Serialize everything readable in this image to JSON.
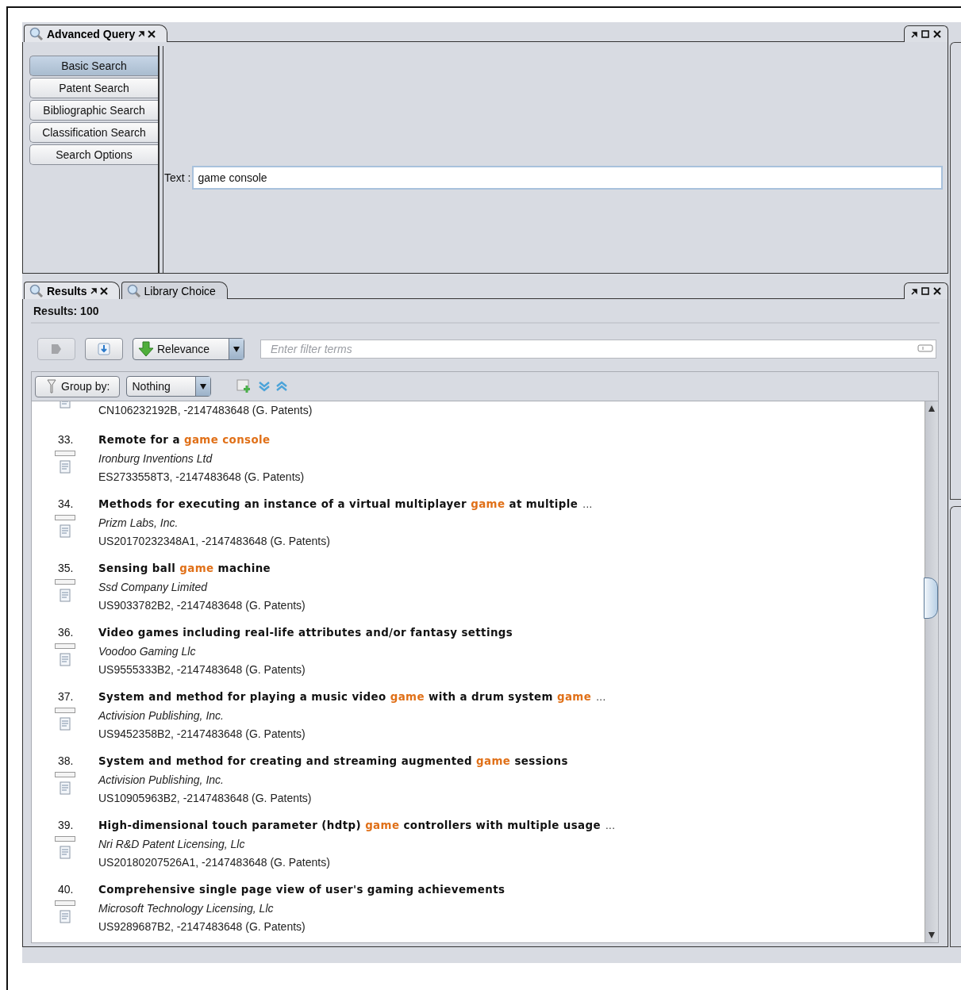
{
  "query_panel": {
    "tab": {
      "label": "Advanced Query",
      "selected": true,
      "closable": true
    },
    "nav": [
      {
        "label": "Basic Search",
        "selected": true
      },
      {
        "label": "Patent Search",
        "selected": false
      },
      {
        "label": "Bibliographic Search",
        "selected": false
      },
      {
        "label": "Classification Search",
        "selected": false
      },
      {
        "label": "Search Options",
        "selected": false
      }
    ],
    "text_field": {
      "label": "Text :",
      "value": "game console"
    }
  },
  "results_panel": {
    "tabs": [
      {
        "label": "Results",
        "selected": true,
        "closable": true
      },
      {
        "label": "Library Choice",
        "selected": false,
        "closable": false
      }
    ],
    "count": "Results: 100",
    "toolbar_buttons": [
      {
        "kind": "export",
        "disabled": true
      },
      {
        "kind": "download",
        "disabled": false
      }
    ],
    "sort": {
      "value": "Relevance"
    },
    "filter": {
      "placeholder": "Enter filter terms"
    },
    "group_by": {
      "label": "Group by:",
      "value": "Nothing"
    },
    "results": [
      {
        "id": "CN106232192B, -2147483648 (G. Patents)"
      },
      {
        "number": "33.",
        "checked": false,
        "title": [
          {
            "text": "Remote for a ",
            "match": false
          },
          {
            "text": "game console",
            "match": true
          }
        ],
        "assignee": "Ironburg Inventions Ltd",
        "id": "ES2733558T3, -2147483648 (G. Patents)"
      },
      {
        "number": "34.",
        "checked": false,
        "title": [
          {
            "text": "Methods for executing an instance of a virtual multiplayer ",
            "match": false
          },
          {
            "text": "game",
            "match": true
          },
          {
            "text": " at multiple",
            "match": false
          }
        ],
        "ellipsis": "...",
        "assignee": "Prizm Labs, Inc.",
        "id": "US20170232348A1, -2147483648 (G. Patents)"
      },
      {
        "number": "35.",
        "checked": false,
        "title": [
          {
            "text": "Sensing ball ",
            "match": false
          },
          {
            "text": "game",
            "match": true
          },
          {
            "text": " machine",
            "match": false
          }
        ],
        "assignee": "Ssd Company Limited",
        "id": "US9033782B2, -2147483648 (G. Patents)"
      },
      {
        "number": "36.",
        "checked": false,
        "title": [
          {
            "text": "Video games including real-life attributes and/or fantasy settings",
            "match": false
          }
        ],
        "assignee": "Voodoo Gaming Llc",
        "id": "US9555333B2, -2147483648 (G. Patents)"
      },
      {
        "number": "37.",
        "checked": false,
        "title": [
          {
            "text": "System and method for playing a music video ",
            "match": false
          },
          {
            "text": "game",
            "match": true
          },
          {
            "text": " with a drum system ",
            "match": false
          },
          {
            "text": "game",
            "match": true
          }
        ],
        "ellipsis": "...",
        "assignee": "Activision Publishing, Inc.",
        "id": "US9452358B2, -2147483648 (G. Patents)"
      },
      {
        "number": "38.",
        "checked": false,
        "title": [
          {
            "text": "System and method for creating and streaming augmented ",
            "match": false
          },
          {
            "text": "game",
            "match": true
          },
          {
            "text": " sessions",
            "match": false
          }
        ],
        "assignee": "Activision Publishing, Inc.",
        "id": "US10905963B2, -2147483648 (G. Patents)"
      },
      {
        "number": "39.",
        "checked": false,
        "title": [
          {
            "text": "High-dimensional touch parameter (hdtp) ",
            "match": false
          },
          {
            "text": "game",
            "match": true
          },
          {
            "text": " controllers with multiple usage",
            "match": false
          }
        ],
        "ellipsis": "...",
        "assignee": "Nri R&D Patent Licensing, Llc",
        "id": "US20180207526A1, -2147483648 (G. Patents)"
      },
      {
        "number": "40.",
        "checked": false,
        "title": [
          {
            "text": "Comprehensive single page view of user's gaming achievements",
            "match": false
          }
        ],
        "assignee": "Microsoft Technology Licensing, Llc",
        "id": "US9289687B2, -2147483648 (G. Patents)"
      }
    ]
  }
}
